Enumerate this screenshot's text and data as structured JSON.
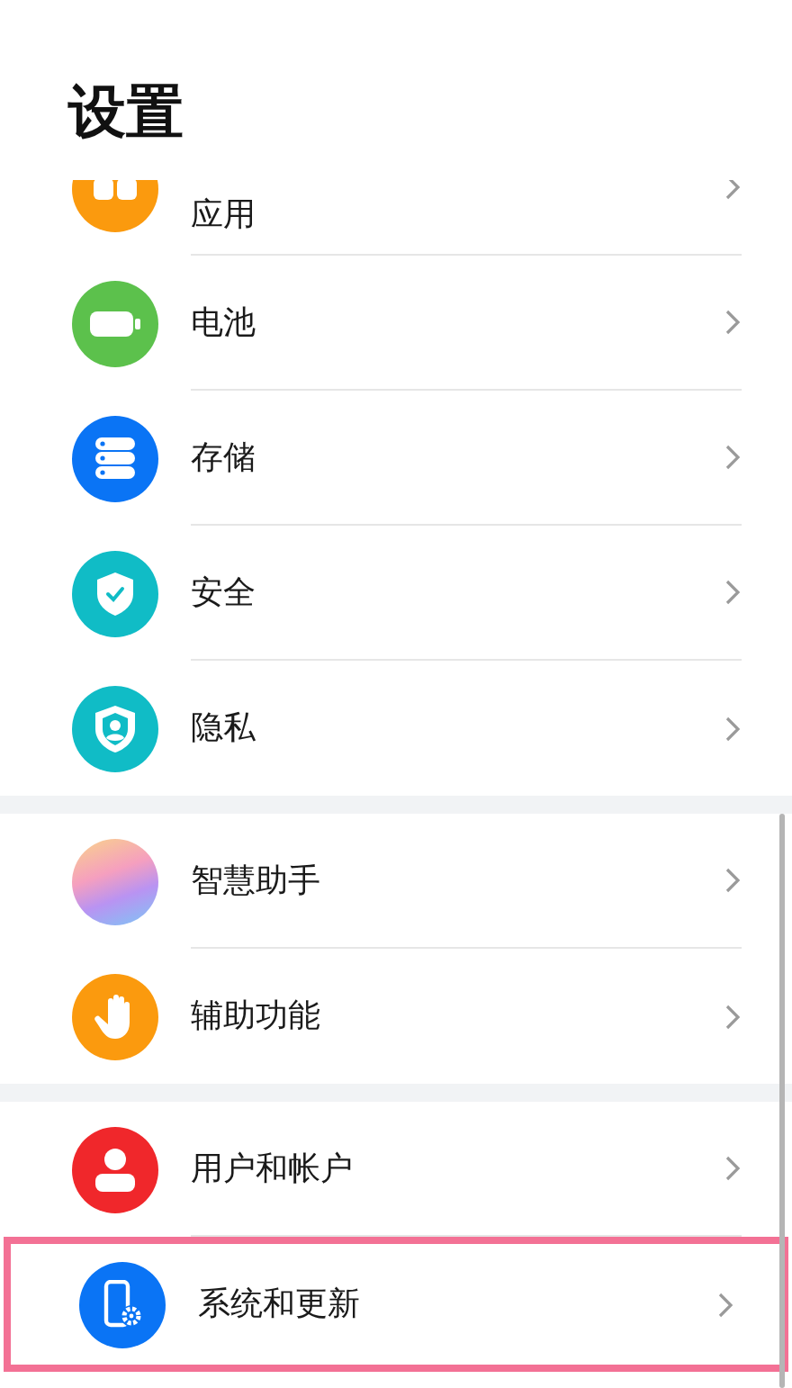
{
  "title": "设置",
  "groups": [
    {
      "items": [
        {
          "label": "应用",
          "kind": "apps",
          "highlighted": false
        },
        {
          "label": "电池",
          "kind": "battery",
          "highlighted": false
        },
        {
          "label": "存储",
          "kind": "storage",
          "highlighted": false
        },
        {
          "label": "安全",
          "kind": "security",
          "highlighted": false
        },
        {
          "label": "隐私",
          "kind": "privacy",
          "highlighted": false
        }
      ]
    },
    {
      "items": [
        {
          "label": "智慧助手",
          "kind": "assistant",
          "highlighted": false
        },
        {
          "label": "辅助功能",
          "kind": "accessibility",
          "highlighted": false
        }
      ]
    },
    {
      "items": [
        {
          "label": "用户和帐户",
          "kind": "user",
          "highlighted": false
        },
        {
          "label": "系统和更新",
          "kind": "system",
          "highlighted": true
        }
      ]
    }
  ]
}
